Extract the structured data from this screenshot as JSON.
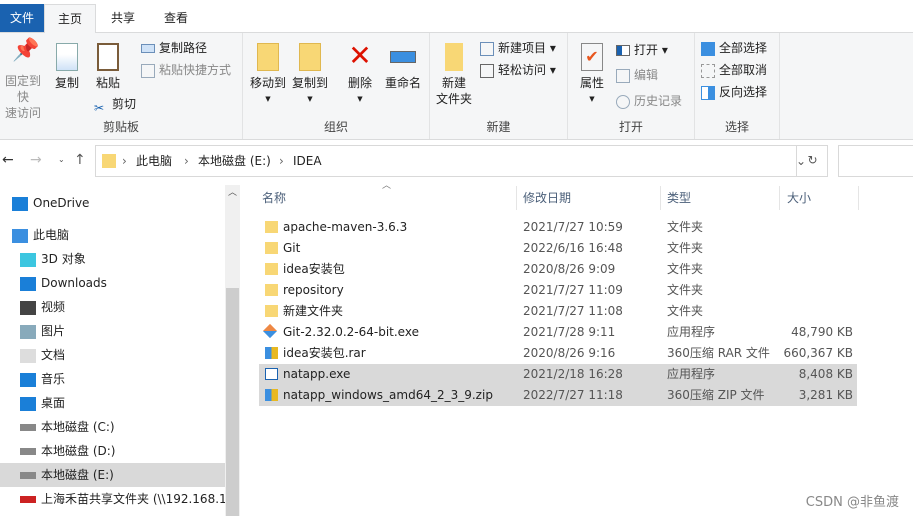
{
  "tabs": {
    "file": "文件",
    "home": "主页",
    "share": "共享",
    "view": "查看"
  },
  "ribbon": {
    "clipboard": {
      "label": "剪贴板",
      "pin": "固定到快\n速访问",
      "copy": "复制",
      "paste": "粘贴",
      "copy_path": "复制路径",
      "paste_shortcut": "粘贴快捷方式",
      "cut": "剪切"
    },
    "organize": {
      "label": "组织",
      "move_to": "移动到",
      "copy_to": "复制到",
      "delete": "删除",
      "rename": "重命名"
    },
    "new": {
      "label": "新建",
      "new_folder": "新建\n文件夹",
      "new_item": "新建项目",
      "easy_access": "轻松访问"
    },
    "open": {
      "label": "打开",
      "properties": "属性",
      "open": "打开",
      "edit": "编辑",
      "history": "历史记录"
    },
    "select": {
      "label": "选择",
      "select_all": "全部选择",
      "select_none": "全部取消",
      "invert": "反向选择"
    }
  },
  "address": {
    "crumbs": [
      "此电脑",
      "本地磁盘 (E:)",
      "IDEA"
    ]
  },
  "nav": [
    {
      "label": "OneDrive",
      "icon": "cloud-icon"
    },
    {
      "label": "此电脑",
      "icon": "computer-icon"
    },
    {
      "label": "3D 对象",
      "icon": "cube-icon"
    },
    {
      "label": "Downloads",
      "icon": "download-icon"
    },
    {
      "label": "视频",
      "icon": "video-icon"
    },
    {
      "label": "图片",
      "icon": "picture-icon"
    },
    {
      "label": "文档",
      "icon": "document-icon"
    },
    {
      "label": "音乐",
      "icon": "music-icon"
    },
    {
      "label": "桌面",
      "icon": "desktop-icon"
    },
    {
      "label": "本地磁盘 (C:)",
      "icon": "drive-icon"
    },
    {
      "label": "本地磁盘 (D:)",
      "icon": "drive-icon"
    },
    {
      "label": "本地磁盘 (E:)",
      "icon": "drive-icon",
      "selected": true
    },
    {
      "label": "上海禾苗共享文件夹 (\\\\192.168.1",
      "icon": "network-drive-icon"
    }
  ],
  "columns": {
    "name": "名称",
    "date": "修改日期",
    "type": "类型",
    "size": "大小"
  },
  "files": [
    {
      "name": "apache-maven-3.6.3",
      "date": "2021/7/27 10:59",
      "type": "文件夹",
      "size": "",
      "icon": "folder"
    },
    {
      "name": "Git",
      "date": "2022/6/16 16:48",
      "type": "文件夹",
      "size": "",
      "icon": "folder"
    },
    {
      "name": "idea安装包",
      "date": "2020/8/26 9:09",
      "type": "文件夹",
      "size": "",
      "icon": "folder"
    },
    {
      "name": "repository",
      "date": "2021/7/27 11:09",
      "type": "文件夹",
      "size": "",
      "icon": "folder"
    },
    {
      "name": "新建文件夹",
      "date": "2021/7/27 11:08",
      "type": "文件夹",
      "size": "",
      "icon": "folder"
    },
    {
      "name": "Git-2.32.0.2-64-bit.exe",
      "date": "2021/7/28 9:11",
      "type": "应用程序",
      "size": "48,790 KB",
      "icon": "git"
    },
    {
      "name": "idea安装包.rar",
      "date": "2020/8/26 9:16",
      "type": "360压缩 RAR 文件",
      "size": "660,367 KB",
      "icon": "archive"
    },
    {
      "name": "natapp.exe",
      "date": "2021/2/18 16:28",
      "type": "应用程序",
      "size": "8,408 KB",
      "icon": "exe",
      "selected": true
    },
    {
      "name": "natapp_windows_amd64_2_3_9.zip",
      "date": "2022/7/27 11:18",
      "type": "360压缩 ZIP 文件",
      "size": "3,281 KB",
      "icon": "archive",
      "selected": true
    }
  ],
  "watermark": "CSDN @非鱼渡",
  "colors": {
    "accent": "#1a62b0",
    "selection": "#d9d9d9",
    "folder": "#f8d775"
  }
}
